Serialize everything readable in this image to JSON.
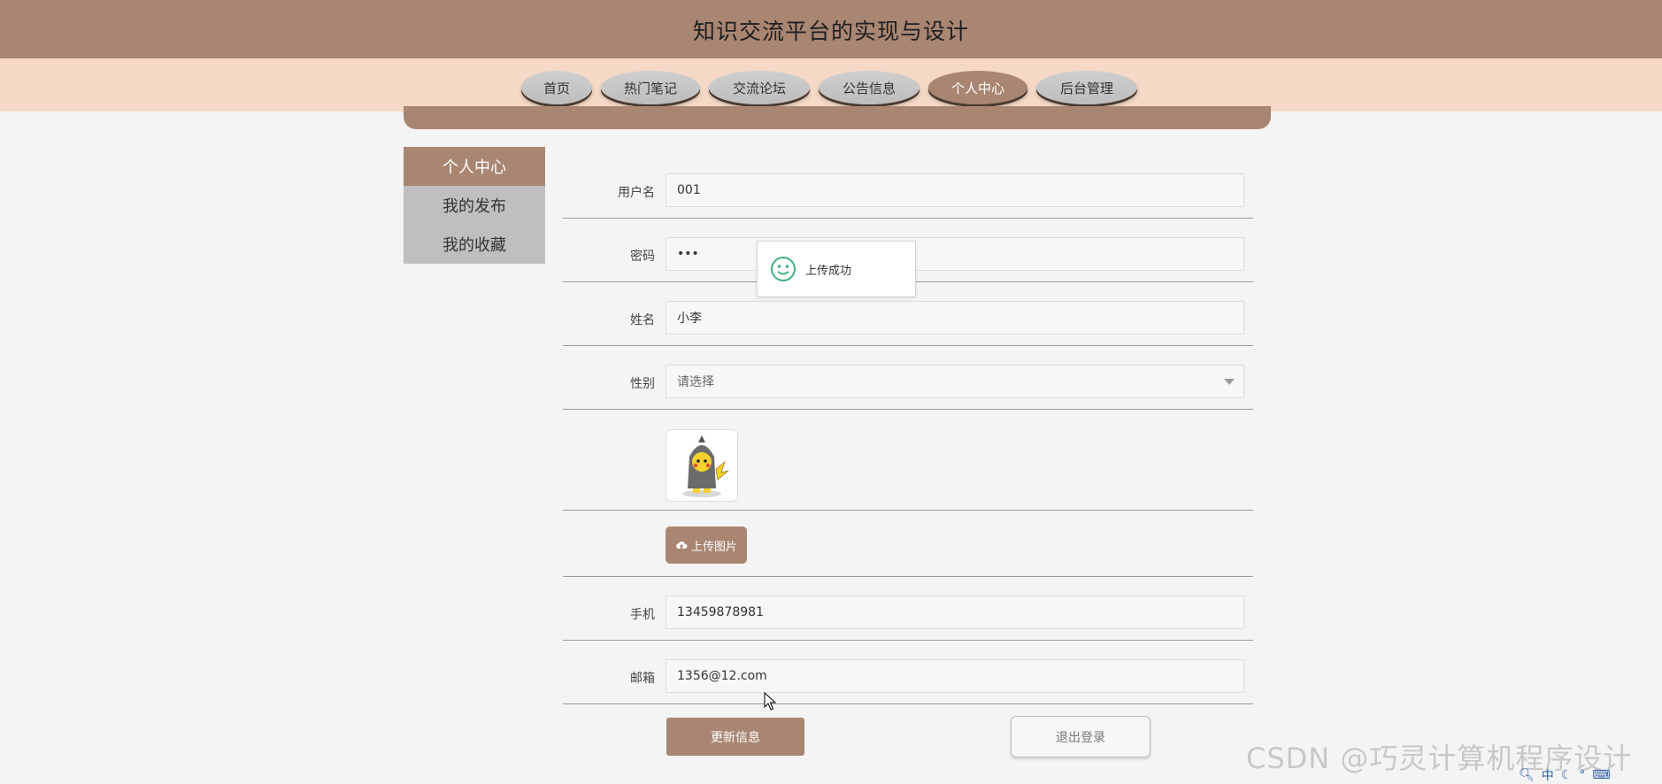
{
  "header": {
    "title": "知识交流平台的实现与设计"
  },
  "nav": {
    "items": [
      {
        "label": "首页"
      },
      {
        "label": "热门笔记"
      },
      {
        "label": "交流论坛"
      },
      {
        "label": "公告信息"
      },
      {
        "label": "个人中心",
        "active": true
      },
      {
        "label": "后台管理"
      }
    ]
  },
  "sidebar": {
    "items": [
      {
        "label": "个人中心",
        "active": true
      },
      {
        "label": "我的发布"
      },
      {
        "label": "我的收藏"
      }
    ]
  },
  "form": {
    "username": {
      "label": "用户名",
      "value": "001"
    },
    "password": {
      "label": "密码",
      "value": "•••"
    },
    "name": {
      "label": "姓名",
      "value": "小李"
    },
    "gender": {
      "label": "性别",
      "placeholder": "请选择"
    },
    "upload_label": "上传图片",
    "phone": {
      "label": "手机",
      "value": "13459878981"
    },
    "email": {
      "label": "邮箱",
      "value": "1356@12.com"
    }
  },
  "actions": {
    "update": "更新信息",
    "logout": "退出登录"
  },
  "toast": {
    "message": "上传成功"
  },
  "watermark": "CSDN @巧灵计算机程序设计",
  "tray": {
    "ime": "中"
  },
  "colors": {
    "accent": "#a98672",
    "nav_bg": "#f5d9c6",
    "toast_icon": "#3fb27f"
  }
}
